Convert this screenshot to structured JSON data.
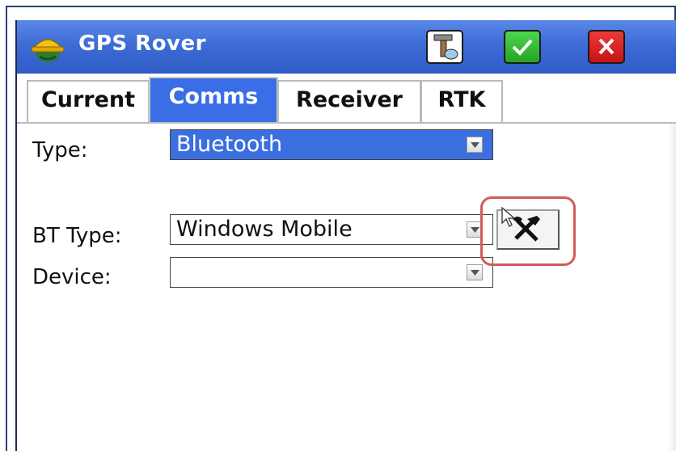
{
  "window": {
    "title": "GPS Rover",
    "app_icon": "hard-hat-icon",
    "buttons": [
      {
        "name": "tool-button",
        "icon": "survey-tool-icon"
      },
      {
        "name": "ok-button",
        "icon": "check-icon"
      },
      {
        "name": "cancel-button",
        "icon": "close-icon"
      }
    ]
  },
  "tabs": [
    {
      "label": "Current",
      "active": false
    },
    {
      "label": "Comms",
      "active": true
    },
    {
      "label": "Receiver",
      "active": false
    },
    {
      "label": "RTK",
      "active": false
    }
  ],
  "form": {
    "type": {
      "label": "Type:",
      "value": "Bluetooth"
    },
    "bt_type": {
      "label": "BT Type:",
      "value": "Windows Mobile"
    },
    "device": {
      "label": "Device:",
      "value": ""
    },
    "config_button_icon": "hammer-wrench-icon"
  },
  "colors": {
    "titlebar": "#3d6cd6",
    "active_tab": "#3a6ee6",
    "highlight_ring": "#d45a5a",
    "ok_green": "#22a622",
    "cancel_red": "#c41414"
  }
}
